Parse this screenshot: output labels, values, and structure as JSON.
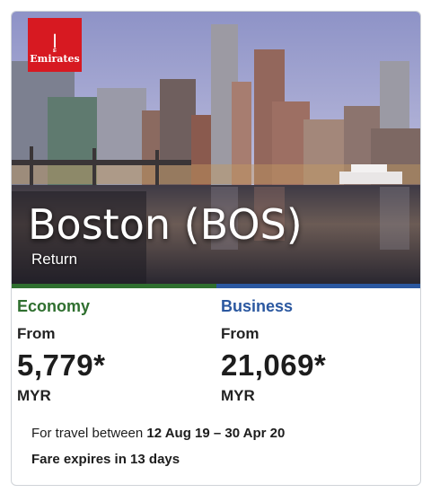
{
  "brand": {
    "logo_text": "Emirates",
    "logo_glyph": "إ",
    "color": "#d71921"
  },
  "destination": {
    "city": "Boston (BOS)",
    "trip_type": "Return"
  },
  "fares": {
    "economy": {
      "class_name": "Economy",
      "from_label": "From",
      "price": "5,779*",
      "currency": "MYR",
      "color": "#2f6f2f"
    },
    "business": {
      "class_name": "Business",
      "from_label": "From",
      "price": "21,069*",
      "currency": "MYR",
      "color": "#2b58a0"
    }
  },
  "travel": {
    "prefix": "For travel between",
    "dates": "12 Aug 19 – 30 Apr 20"
  },
  "expiry": {
    "text": "Fare expires in 13 days"
  }
}
